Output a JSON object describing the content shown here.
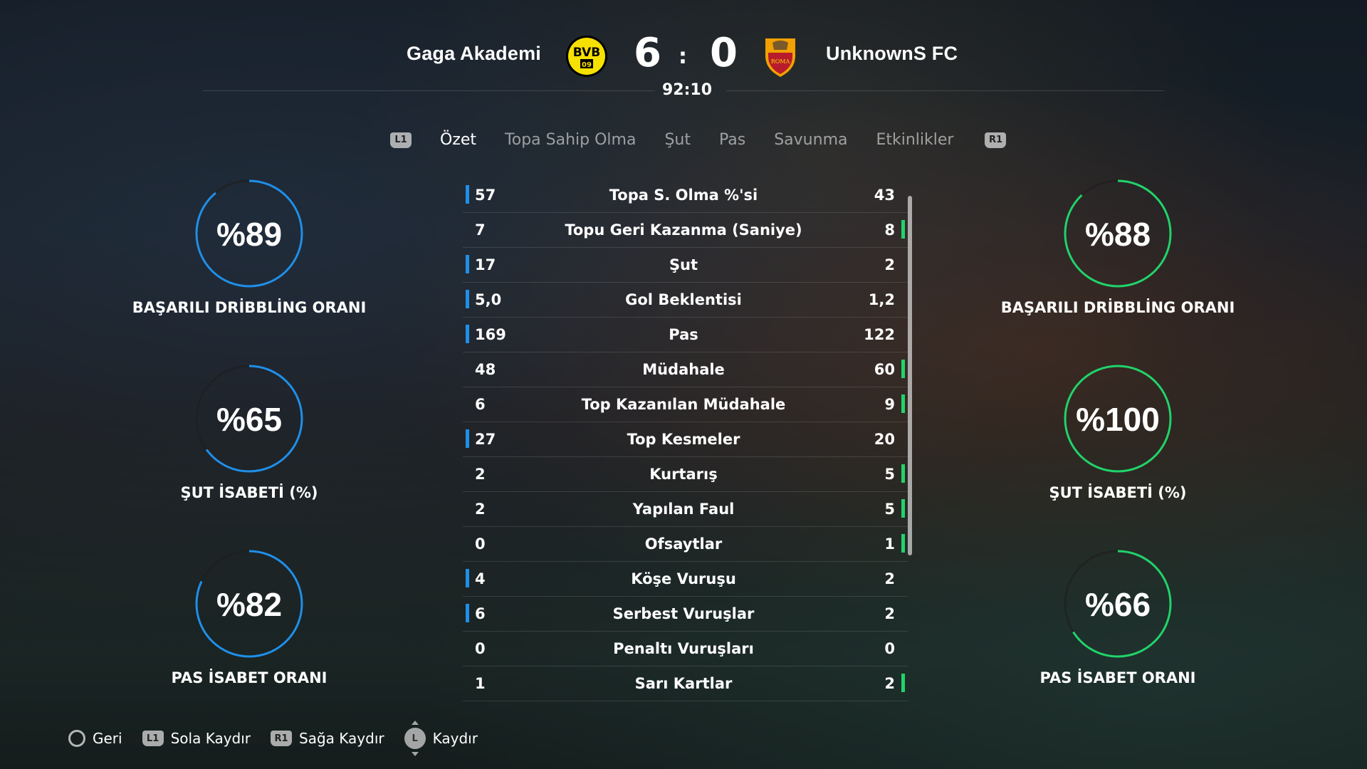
{
  "header": {
    "home_team": "Gaga Akademi",
    "away_team": "UnknownS FC",
    "home_score": "6",
    "score_separator": ":",
    "away_score": "0",
    "clock": "92:10",
    "home_crest": {
      "text_top": "BVB",
      "text_bottom": "09",
      "color": "#f6e000"
    },
    "away_crest": {
      "text": "ROMA",
      "color": "#b81c2c"
    }
  },
  "tabs": {
    "left_button": "L1",
    "right_button": "R1",
    "items": [
      "Özet",
      "Topa Sahip Olma",
      "Şut",
      "Pas",
      "Savunma",
      "Etkinlikler"
    ],
    "active": "Özet"
  },
  "stats": [
    {
      "home": "57",
      "label": "Topa S. Olma %'si",
      "away": "43",
      "leader": "home"
    },
    {
      "home": "7",
      "label": "Topu Geri Kazanma (Saniye)",
      "away": "8",
      "leader": "away"
    },
    {
      "home": "17",
      "label": "Şut",
      "away": "2",
      "leader": "home"
    },
    {
      "home": "5,0",
      "label": "Gol Beklentisi",
      "away": "1,2",
      "leader": "home"
    },
    {
      "home": "169",
      "label": "Pas",
      "away": "122",
      "leader": "home"
    },
    {
      "home": "48",
      "label": "Müdahale",
      "away": "60",
      "leader": "away"
    },
    {
      "home": "6",
      "label": "Top Kazanılan Müdahale",
      "away": "9",
      "leader": "away"
    },
    {
      "home": "27",
      "label": "Top Kesmeler",
      "away": "20",
      "leader": "home"
    },
    {
      "home": "2",
      "label": "Kurtarış",
      "away": "5",
      "leader": "away"
    },
    {
      "home": "2",
      "label": "Yapılan Faul",
      "away": "5",
      "leader": "away"
    },
    {
      "home": "0",
      "label": "Ofsaytlar",
      "away": "1",
      "leader": "away"
    },
    {
      "home": "4",
      "label": "Köşe Vuruşu",
      "away": "2",
      "leader": "home"
    },
    {
      "home": "6",
      "label": "Serbest Vuruşlar",
      "away": "2",
      "leader": "home"
    },
    {
      "home": "0",
      "label": "Penaltı Vuruşları",
      "away": "0",
      "leader": "none"
    },
    {
      "home": "1",
      "label": "Sarı Kartlar",
      "away": "2",
      "leader": "away"
    }
  ],
  "rings": {
    "home": [
      {
        "text": "%89",
        "value": 89,
        "label": "BAŞARILI DRİBBLİNG ORANI"
      },
      {
        "text": "%65",
        "value": 65,
        "label": "ŞUT İSABETİ (%)"
      },
      {
        "text": "%82",
        "value": 82,
        "label": "PAS İSABET ORANI"
      }
    ],
    "away": [
      {
        "text": "%88",
        "value": 88,
        "label": "BAŞARILI DRİBBLİNG ORANI"
      },
      {
        "text": "%100",
        "value": 100,
        "label": "ŞUT İSABETİ (%)"
      },
      {
        "text": "%66",
        "value": 66,
        "label": "PAS İSABET ORANI"
      }
    ],
    "home_color": "#1f8fe8",
    "away_color": "#21d36a"
  },
  "footer": {
    "back": "Geri",
    "l1_badge": "L1",
    "scroll_left": "Sola Kaydır",
    "r1_badge": "R1",
    "scroll_right": "Sağa Kaydır",
    "stick_badge": "L",
    "scroll": "Kaydır"
  }
}
